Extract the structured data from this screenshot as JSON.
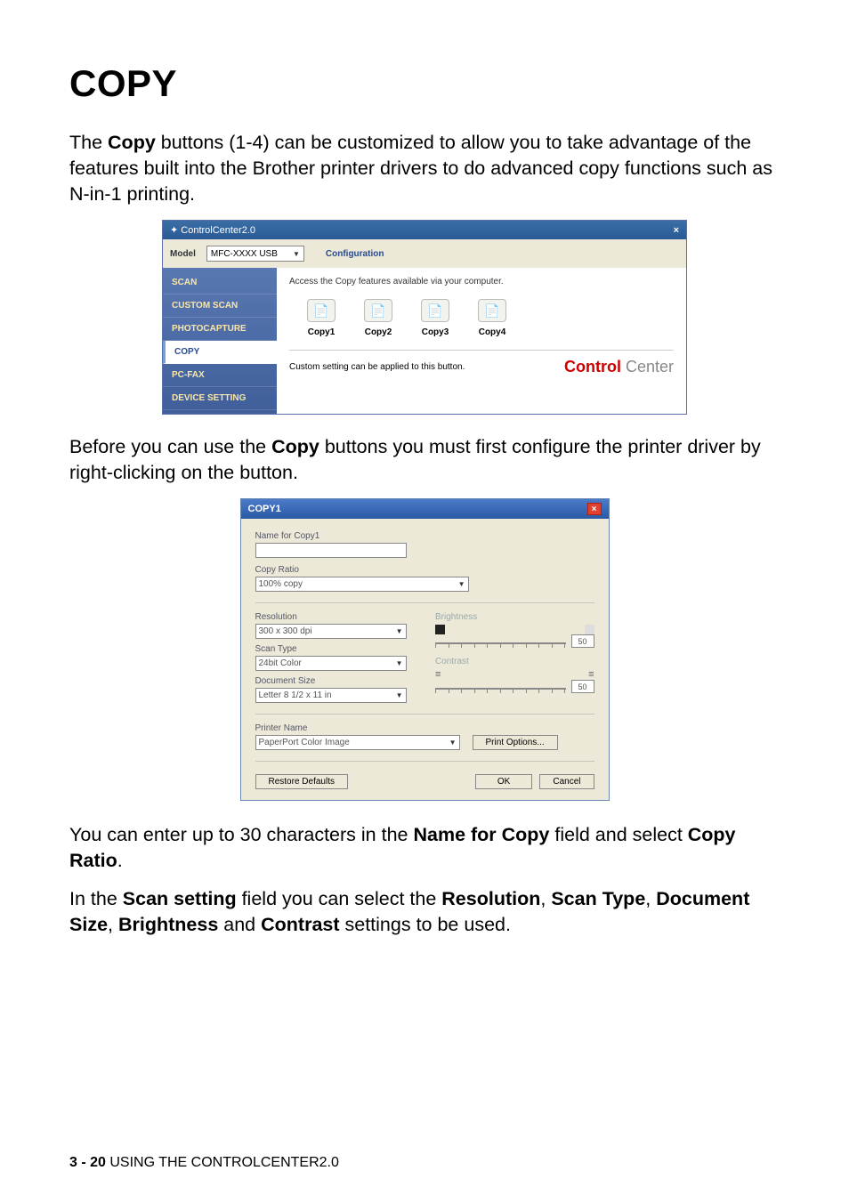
{
  "heading": "COPY",
  "intro_1a": "The ",
  "intro_1b": "Copy",
  "intro_1c": " buttons (1-4) can be customized to allow you to take advantage of the features built into the Brother printer drivers to do advanced copy functions such as N-in-1 printing.",
  "cc": {
    "title": "ControlCenter2.0",
    "close": "×",
    "model_label": "Model",
    "model_value": "MFC-XXXX USB",
    "configuration": "Configuration",
    "sidebar": [
      "SCAN",
      "CUSTOM SCAN",
      "PHOTOCAPTURE",
      "COPY",
      "PC-FAX",
      "DEVICE SETTING"
    ],
    "active_index": 3,
    "desc": "Access the Copy features available via your computer.",
    "items": [
      "Copy1",
      "Copy2",
      "Copy3",
      "Copy4"
    ],
    "footer_text": "Custom setting can be applied to this button.",
    "brand_strong": "Control",
    "brand_light": " Center"
  },
  "para2a": "Before you can use the ",
  "para2b": "Copy",
  "para2c": " buttons you must first configure the printer driver by right-clicking on the button.",
  "dlg": {
    "title": "COPY1",
    "name_label": "Name for Copy1",
    "name_value": "",
    "ratio_label": "Copy Ratio",
    "ratio_value": "100% copy",
    "res_label": "Resolution",
    "res_value": "300 x 300 dpi",
    "type_label": "Scan Type",
    "type_value": "24bit Color",
    "docsize_label": "Document Size",
    "docsize_value": "Letter 8 1/2 x 11 in",
    "brightness_label": "Brightness",
    "brightness_value": "50",
    "contrast_label": "Contrast",
    "contrast_value": "50",
    "printer_label": "Printer Name",
    "printer_value": "PaperPort Color Image",
    "print_options": "Print Options...",
    "restore": "Restore Defaults",
    "ok": "OK",
    "cancel": "Cancel"
  },
  "para3a": "You can enter up to 30 characters in the ",
  "para3b": "Name for Copy",
  "para3c": " field and select ",
  "para3d": "Copy Ratio",
  "para3e": ".",
  "para4a": "In the ",
  "para4b": "Scan setting",
  "para4c": " field you can select the ",
  "para4d": "Resolution",
  "para4e": ", ",
  "para4f": "Scan Type",
  "para4g": ", ",
  "para4h": "Document Size",
  "para4i": ", ",
  "para4j": "Brightness",
  "para4k": " and ",
  "para4l": "Contrast",
  "para4m": " settings to be used.",
  "footer_page": "3 - 20",
  "footer_text": "   USING THE CONTROLCENTER2.0"
}
